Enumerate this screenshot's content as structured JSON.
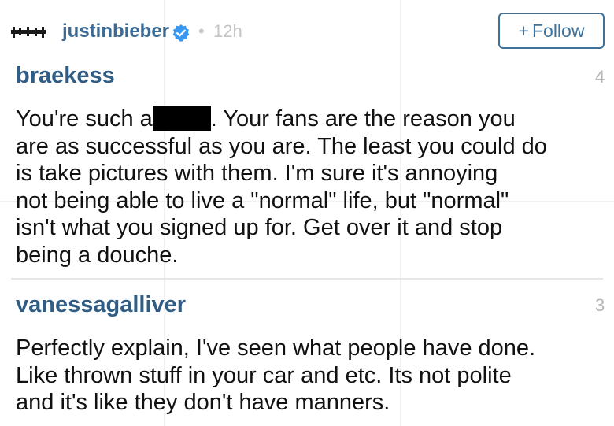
{
  "post": {
    "username": "justinbieber",
    "separator": "•",
    "time_ago": "12h",
    "follow_label": "Follow",
    "follow_plus": "+"
  },
  "comments": [
    {
      "username": "braekess",
      "count": "4",
      "text_before": "You're such a",
      "text_after": ". Your fans are the reason you",
      "lines": [
        "are as successful as you are. The least you could do",
        "is take pictures with them. I'm sure it's annoying",
        "not being able to live a \"normal\" life, but \"normal\"",
        "isn't what you signed up for. Get over it and stop",
        "being a douche."
      ]
    },
    {
      "username": "vanessagalliver",
      "count": "3",
      "lines": [
        "Perfectly explain,  I've seen what people have done.",
        "Like thrown stuff in your car and etc. Its not polite",
        "and it's like they don't have manners."
      ]
    }
  ],
  "colors": {
    "username_blue": "#3b6b94",
    "follow_blue": "#3f729b",
    "verified_blue": "#3897f0"
  },
  "icons": {
    "avatar": "avatar-icon",
    "verified": "verified-badge-icon",
    "redaction": "redaction-bar"
  }
}
